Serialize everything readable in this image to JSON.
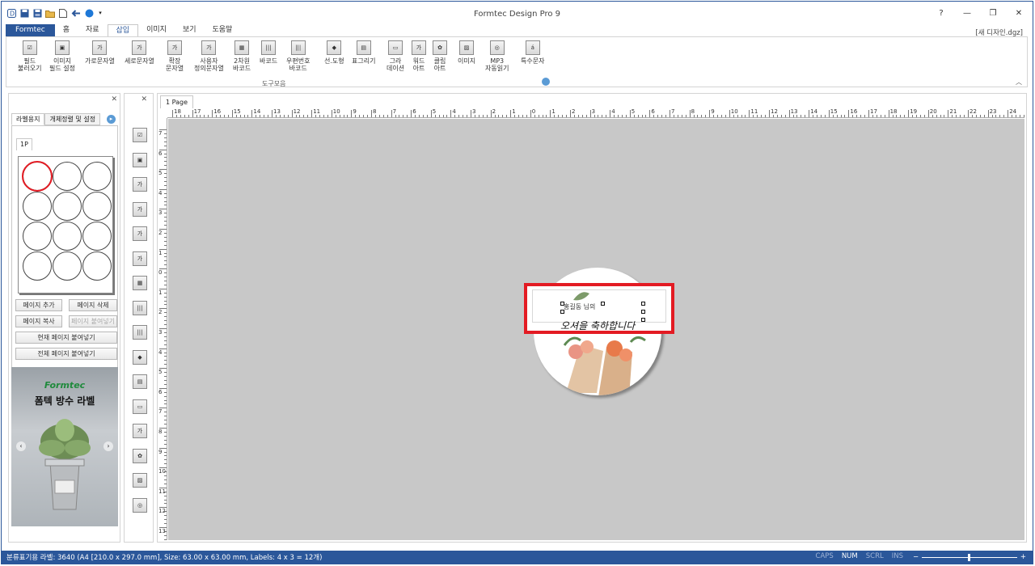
{
  "window": {
    "title": "Formtec Design Pro 9",
    "document_name": "[새 디자인.dgz]"
  },
  "quick_access": [
    "app-logo-icon",
    "save-icon",
    "save-all-icon",
    "open-folder-icon",
    "new-document-icon",
    "undo-icon",
    "redo-icon",
    "dropdown-icon"
  ],
  "tabs": [
    {
      "label": "Formtec",
      "key": "app"
    },
    {
      "label": "홈",
      "key": "home"
    },
    {
      "label": "자료",
      "key": "data"
    },
    {
      "label": "삽입",
      "key": "insert"
    },
    {
      "label": "이미지",
      "key": "image"
    },
    {
      "label": "보기",
      "key": "view"
    },
    {
      "label": "도움말",
      "key": "help"
    }
  ],
  "active_tab": "삽입",
  "ribbon": {
    "buttons": [
      {
        "label": "필드\n불러오기",
        "icon": "field-load-icon",
        "glyph": "☑"
      },
      {
        "label": "이미지\n필드 설정",
        "icon": "image-field-icon",
        "glyph": "▣"
      },
      {
        "label": "가로문자열",
        "icon": "horizontal-text-icon",
        "glyph": "가"
      },
      {
        "label": "세로문자열",
        "icon": "vertical-text-icon",
        "glyph": "가"
      },
      {
        "label": "확장\n문자열",
        "icon": "extended-text-icon",
        "glyph": "가"
      },
      {
        "label": "사용자\n정의문자열",
        "icon": "custom-text-icon",
        "glyph": "가"
      },
      {
        "label": "2차원\n바코드",
        "icon": "qr-code-icon",
        "glyph": "▦"
      },
      {
        "label": "바코드",
        "icon": "barcode-icon",
        "glyph": "|||"
      },
      {
        "label": "우편번호\n바코드",
        "icon": "postal-barcode-icon",
        "glyph": "|||"
      },
      {
        "label": "선.도형",
        "icon": "shapes-icon",
        "glyph": "◆"
      },
      {
        "label": "표그리기",
        "icon": "table-icon",
        "glyph": "▤"
      },
      {
        "label": "그라\n데이션",
        "icon": "gradient-icon",
        "glyph": "▭"
      },
      {
        "label": "워드\n아트",
        "icon": "word-art-icon",
        "glyph": "가"
      },
      {
        "label": "클립\n아트",
        "icon": "clip-art-icon",
        "glyph": "✿"
      },
      {
        "label": "이미지",
        "icon": "image-icon",
        "glyph": "▨"
      },
      {
        "label": "MP3\n자동읽기",
        "icon": "mp3-disc-icon",
        "glyph": "◎"
      },
      {
        "label": "특수문자",
        "icon": "special-char-icon",
        "glyph": "á"
      }
    ],
    "group_label": "도구모음"
  },
  "left_panel": {
    "tabs": [
      "라벨용지",
      "개체정렬 및 설정"
    ],
    "page_tab": "1P",
    "buttons": {
      "add_page": "페이지 추가",
      "delete_page": "페이지 삭제",
      "copy_page": "페이지 복사",
      "paste_page": "페이지 붙여넣기",
      "paste_current": "현재 페이지 붙여넣기",
      "paste_all": "전체 페이지 붙여넣기"
    },
    "ad": {
      "brand": "Formtec",
      "title": "폼텍 방수 라벨"
    }
  },
  "toolbox_icons": [
    "field-load-icon",
    "image-field-icon",
    "horizontal-text-icon",
    "vertical-text-icon",
    "extended-text-icon",
    "custom-text-icon",
    "qr-code-icon",
    "barcode-icon",
    "postal-barcode-icon",
    "shapes-icon",
    "table-icon",
    "gradient-icon",
    "word-art-icon",
    "clip-art-icon",
    "image-icon",
    "mp3-disc-icon"
  ],
  "document": {
    "page_tab": "1 Page",
    "label_name": "홍길동 님의",
    "label_script": "오셔을 축하합니다"
  },
  "rulers": {
    "h_labels": [
      "18",
      "17",
      "16",
      "15",
      "14",
      "13",
      "12",
      "11",
      "10",
      "9",
      "8",
      "7",
      "6",
      "5",
      "4",
      "3",
      "2",
      "1",
      "0",
      "1",
      "2",
      "3",
      "4",
      "5",
      "6",
      "7",
      "8",
      "9",
      "10",
      "11",
      "12",
      "13",
      "14",
      "15",
      "16",
      "17",
      "18",
      "19",
      "20",
      "21",
      "22",
      "23",
      "24"
    ],
    "v_labels": [
      "7",
      "6",
      "5",
      "4",
      "3",
      "2",
      "1",
      "0",
      "1",
      "2",
      "3",
      "4",
      "5",
      "6",
      "7",
      "8",
      "9",
      "10",
      "11",
      "12",
      "13"
    ]
  },
  "status": {
    "text": "분류표기용 라벨: 3640 (A4 [210.0 x 297.0 mm], Size: 63.00 x 63.00 mm,  Labels: 4 x 3 = 12개)",
    "keys": [
      {
        "label": "CAPS",
        "on": false
      },
      {
        "label": "NUM",
        "on": true
      },
      {
        "label": "SCRL",
        "on": false
      },
      {
        "label": "INS",
        "on": false
      }
    ],
    "zoom_minus": "−",
    "zoom_plus": "+"
  },
  "colors": {
    "accent": "#2b579a",
    "selection": "#e31b23",
    "canvas": "#c8c8c8"
  }
}
